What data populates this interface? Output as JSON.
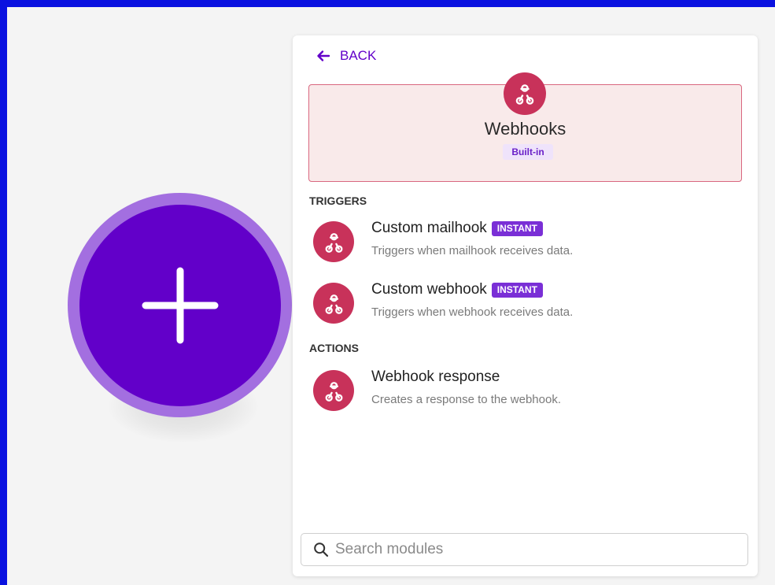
{
  "colors": {
    "frame": "#0a12e0",
    "canvas": "#f4f4f4",
    "bubble_ring": "#a36fe0",
    "bubble_fill": "#6200c9",
    "accent": "#6200c9",
    "app_brand": "#c8325a",
    "card_bg": "#f9eaea",
    "card_border": "#d9677f",
    "instant_badge": "#7a2fd6"
  },
  "canvas": {
    "add_icon": "plus-icon"
  },
  "panel": {
    "back": {
      "icon": "arrow-left-icon",
      "label": "BACK"
    },
    "app": {
      "icon": "webhook-icon",
      "title": "Webhooks",
      "badge": "Built-in"
    },
    "sections": {
      "triggers": {
        "label": "TRIGGERS",
        "items": [
          {
            "icon": "webhook-icon",
            "name": "Custom mailhook",
            "badge": "INSTANT",
            "description": "Triggers when mailhook receives data."
          },
          {
            "icon": "webhook-icon",
            "name": "Custom webhook",
            "badge": "INSTANT",
            "description": "Triggers when webhook receives data."
          }
        ]
      },
      "actions": {
        "label": "ACTIONS",
        "items": [
          {
            "icon": "webhook-icon",
            "name": "Webhook response",
            "description": "Creates a response to the webhook."
          }
        ]
      }
    },
    "search": {
      "icon": "search-icon",
      "value": "",
      "placeholder": "Search modules"
    }
  }
}
